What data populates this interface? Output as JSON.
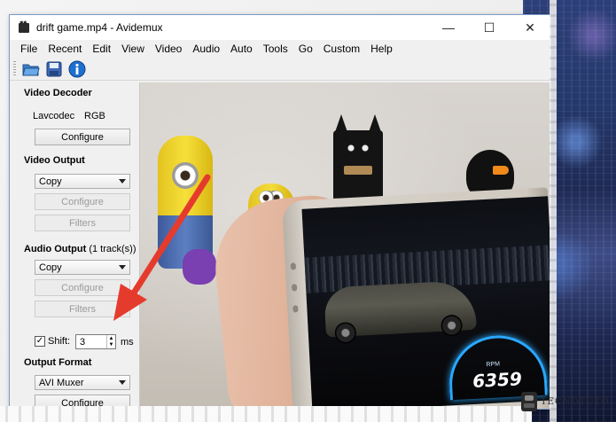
{
  "window": {
    "title": "drift game.mp4 - Avidemux",
    "controls": [
      "—",
      "☐",
      "✕"
    ]
  },
  "menubar": [
    "File",
    "Recent",
    "Edit",
    "View",
    "Video",
    "Audio",
    "Auto",
    "Tools",
    "Go",
    "Custom",
    "Help"
  ],
  "toolbar": {
    "icons": [
      "open-folder-icon",
      "save-disk-icon",
      "info-icon"
    ]
  },
  "sidebar": {
    "video_decoder": {
      "title": "Video Decoder",
      "codec": "Lavcodec",
      "format": "RGB",
      "configure": "Configure"
    },
    "video_output": {
      "title": "Video Output",
      "selected": "Copy",
      "configure": "Configure",
      "filters": "Filters"
    },
    "audio_output": {
      "title": "Audio Output",
      "subtitle": "(1 track(s))",
      "selected": "Copy",
      "configure": "Configure",
      "filters": "Filters",
      "shift_label": "Shift:",
      "shift_checked": true,
      "shift_value": "3",
      "shift_unit": "ms"
    },
    "output_format": {
      "title": "Output Format",
      "selected": "AVI Muxer",
      "configure": "Configure"
    }
  },
  "video_preview": {
    "game_speed": "6359",
    "game_rpm_label": "RPM"
  },
  "watermark": {
    "brand": "TECNOTUTO"
  },
  "colors": {
    "annotation_arrow": "#e53b2c",
    "window_border": "#7a9cc7",
    "gauge_glow": "#2aa8ff"
  }
}
